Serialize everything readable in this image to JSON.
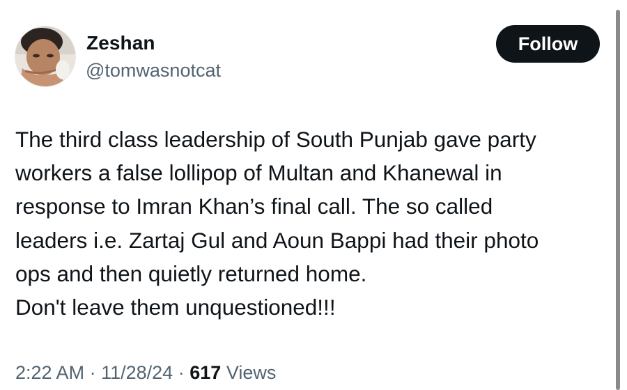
{
  "author": {
    "display_name": "Zeshan",
    "handle": "@tomwasnotcat"
  },
  "header": {
    "follow_label": "Follow"
  },
  "tweet": {
    "lines": [
      "The third class leadership of South Punjab gave party",
      "workers a false lollipop of Multan and Khanewal in",
      "response to Imran Khan’s final call. The so called",
      "leaders i.e. Zartaj Gul and Aoun Bappi had their photo",
      "ops and then quietly returned home.",
      "Don't leave them unquestioned!!!"
    ]
  },
  "meta": {
    "time": "2:22 AM",
    "separator": "·",
    "date": "11/28/24",
    "views_count": "617",
    "views_label": "Views"
  },
  "colors": {
    "text_primary": "#0f1419",
    "text_secondary": "#536471",
    "button_bg": "#0f1419",
    "button_text": "#ffffff"
  }
}
